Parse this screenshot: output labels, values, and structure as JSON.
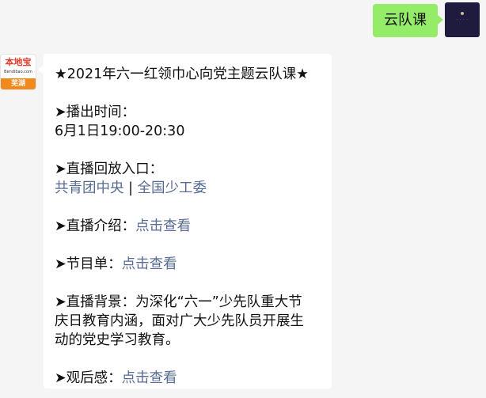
{
  "outgoing": {
    "text": "云队课",
    "avatar_icon": "brand-avatar-icon"
  },
  "incoming": {
    "avatar": {
      "brand": "本地宝",
      "site": "Bendibao.com",
      "city": "芜湖"
    },
    "title": "★2021年六一红领巾心向党主题云队课★",
    "broadcast_time_label": "➤播出时间：",
    "broadcast_time_value": "6月1日19:00-20:30",
    "replay_label": "➤直播回放入口：",
    "replay_link_1": "共青团中央",
    "replay_separator": " | ",
    "replay_link_2": "全国少工委",
    "intro_label": "➤直播介绍：",
    "intro_link": "点击查看",
    "program_label": "➤节目单：",
    "program_link": "点击查看",
    "background_label": "➤直播背景：为深化“六一”少先队重大节",
    "background_line2": "庆日教育内涵，面对广大少先队员开展生",
    "background_line3": "动的党史学习教育。",
    "feedback_label": "➤观后感：",
    "feedback_link": "点击查看"
  },
  "colors": {
    "outgoing_bubble": "#95ec69",
    "link": "#576b95",
    "background": "#f5f5f5"
  }
}
